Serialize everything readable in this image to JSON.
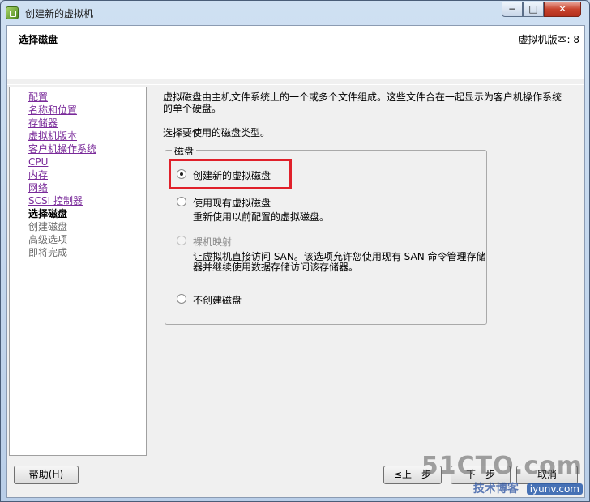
{
  "window": {
    "title": "创建新的虚拟机",
    "minimize": "−",
    "maximize": "□",
    "close": "✕"
  },
  "header": {
    "page_title": "选择磁盘",
    "version": "虚拟机版本: 8"
  },
  "nav": {
    "items": [
      {
        "label": "配置",
        "state": "link"
      },
      {
        "label": "名称和位置",
        "state": "link"
      },
      {
        "label": "存储器",
        "state": "link"
      },
      {
        "label": "虚拟机版本",
        "state": "link"
      },
      {
        "label": "客户机操作系统",
        "state": "link"
      },
      {
        "label": "CPU",
        "state": "link"
      },
      {
        "label": "内存",
        "state": "link"
      },
      {
        "label": "网络",
        "state": "link"
      },
      {
        "label": "SCSI 控制器",
        "state": "link"
      },
      {
        "label": "选择磁盘",
        "state": "current"
      },
      {
        "label": "创建磁盘",
        "state": "disabled"
      },
      {
        "label": "高级选项",
        "state": "disabled"
      },
      {
        "label": "即将完成",
        "state": "disabled"
      }
    ]
  },
  "main": {
    "description": "虚拟磁盘由主机文件系统上的一个或多个文件组成。这些文件合在一起显示为客户机操作系统的单个硬盘。",
    "prompt": "选择要使用的磁盘类型。",
    "group_label": "磁盘",
    "options": {
      "create_new": {
        "label": "创建新的虚拟磁盘",
        "checked": true
      },
      "use_existing": {
        "label": "使用现有虚拟磁盘",
        "sub": "重新使用以前配置的虚拟磁盘。"
      },
      "raw_mapping": {
        "label": "裸机映射",
        "sub1": "让虚拟机直接访问 SAN。该选项允许您使用现有 SAN 命令管理存储",
        "sub2": "器并继续使用数据存储访问该存储器。",
        "disabled": true
      },
      "no_disk": {
        "label": "不创建磁盘"
      }
    }
  },
  "footer": {
    "help": "帮助(H)",
    "back": "≤上一步",
    "next": "下一步",
    "cancel": "取消"
  },
  "watermark": {
    "big": "51CTO.com",
    "small": "技术博客",
    "url": "iyunv.com"
  },
  "colors": {
    "highlight": "#e0202a",
    "link": "#7a2b9a"
  }
}
